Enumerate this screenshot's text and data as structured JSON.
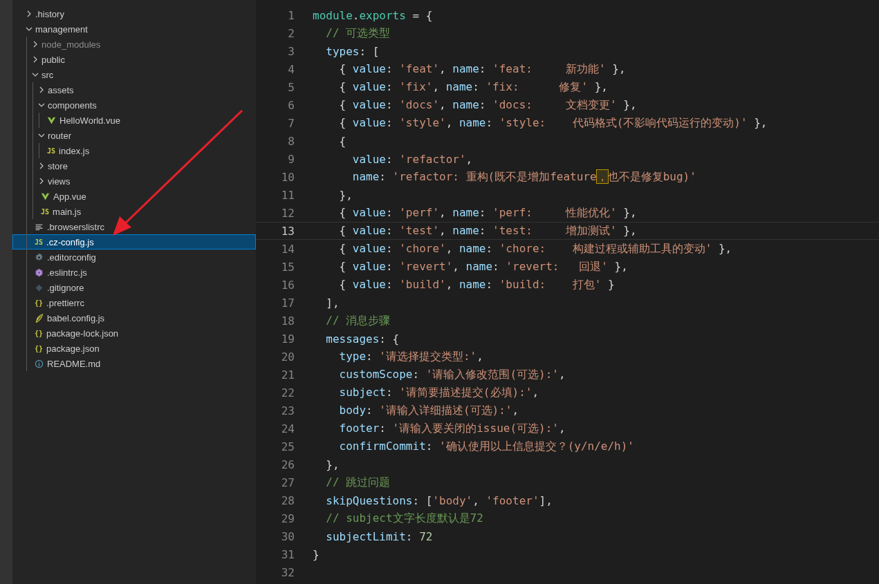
{
  "explorer": {
    "items": [
      {
        "name": ".history",
        "kind": "folder",
        "expanded": false,
        "selected": false,
        "dimmed": false
      },
      {
        "name": "management",
        "kind": "folder",
        "expanded": true,
        "selected": false,
        "dimmed": false,
        "children": [
          {
            "name": "node_modules",
            "kind": "folder",
            "expanded": false,
            "selected": false,
            "dimmed": true
          },
          {
            "name": "public",
            "kind": "folder",
            "expanded": false,
            "selected": false,
            "dimmed": false
          },
          {
            "name": "src",
            "kind": "folder",
            "expanded": true,
            "selected": false,
            "dimmed": false,
            "children": [
              {
                "name": "assets",
                "kind": "folder",
                "expanded": false,
                "selected": false,
                "dimmed": false
              },
              {
                "name": "components",
                "kind": "folder",
                "expanded": true,
                "selected": false,
                "dimmed": false,
                "children": [
                  {
                    "name": "HelloWorld.vue",
                    "kind": "vue",
                    "selected": false,
                    "dimmed": false
                  }
                ]
              },
              {
                "name": "router",
                "kind": "folder",
                "expanded": true,
                "selected": false,
                "dimmed": false,
                "children": [
                  {
                    "name": "index.js",
                    "kind": "js",
                    "icon_text": "JS",
                    "selected": false,
                    "dimmed": false
                  }
                ]
              },
              {
                "name": "store",
                "kind": "folder",
                "expanded": false,
                "selected": false,
                "dimmed": false
              },
              {
                "name": "views",
                "kind": "folder",
                "expanded": false,
                "selected": false,
                "dimmed": false
              },
              {
                "name": "App.vue",
                "kind": "vue",
                "selected": false,
                "dimmed": false
              },
              {
                "name": "main.js",
                "kind": "js",
                "icon_text": "JS",
                "selected": false,
                "dimmed": false
              }
            ]
          },
          {
            "name": ".browserslistrc",
            "kind": "text",
            "selected": false,
            "dimmed": false
          },
          {
            "name": ".cz-config.js",
            "kind": "js",
            "icon_text": "JS",
            "selected": true,
            "dimmed": false
          },
          {
            "name": ".editorconfig",
            "kind": "gear",
            "selected": false,
            "dimmed": false
          },
          {
            "name": ".eslintrc.js",
            "kind": "eslint",
            "selected": false,
            "dimmed": false
          },
          {
            "name": ".gitignore",
            "kind": "git",
            "selected": false,
            "dimmed": false
          },
          {
            "name": ".prettierrc",
            "kind": "json",
            "icon_text": "{}",
            "selected": false,
            "dimmed": false
          },
          {
            "name": "babel.config.js",
            "kind": "babel",
            "selected": false,
            "dimmed": false
          },
          {
            "name": "package-lock.json",
            "kind": "json",
            "icon_text": "{}",
            "selected": false,
            "dimmed": false
          },
          {
            "name": "package.json",
            "kind": "json",
            "icon_text": "{}",
            "selected": false,
            "dimmed": false
          },
          {
            "name": "README.md",
            "kind": "info",
            "selected": false,
            "dimmed": false
          }
        ]
      }
    ]
  },
  "editor": {
    "lines": [
      {
        "number": "1",
        "current": false,
        "tokens": [
          {
            "kind": "keyword",
            "text": "module"
          },
          {
            "kind": "punct",
            "text": "."
          },
          {
            "kind": "keyword",
            "text": "exports"
          },
          {
            "kind": "punct",
            "text": " = {"
          }
        ]
      },
      {
        "number": "2",
        "current": false,
        "tokens": [
          {
            "kind": "comment",
            "text": "  // 可选类型"
          }
        ]
      },
      {
        "number": "3",
        "current": false,
        "tokens": [
          {
            "kind": "property",
            "text": "  types"
          },
          {
            "kind": "punct",
            "text": ": ["
          }
        ]
      },
      {
        "number": "4",
        "current": false,
        "tokens": [
          {
            "kind": "punct",
            "text": "    { "
          },
          {
            "kind": "property",
            "text": "value"
          },
          {
            "kind": "punct",
            "text": ": "
          },
          {
            "kind": "string",
            "text": "'feat'"
          },
          {
            "kind": "punct",
            "text": ", "
          },
          {
            "kind": "property",
            "text": "name"
          },
          {
            "kind": "punct",
            "text": ": "
          },
          {
            "kind": "string",
            "text": "'feat:     新功能'"
          },
          {
            "kind": "punct",
            "text": " },"
          }
        ]
      },
      {
        "number": "5",
        "current": false,
        "tokens": [
          {
            "kind": "punct",
            "text": "    { "
          },
          {
            "kind": "property",
            "text": "value"
          },
          {
            "kind": "punct",
            "text": ": "
          },
          {
            "kind": "string",
            "text": "'fix'"
          },
          {
            "kind": "punct",
            "text": ", "
          },
          {
            "kind": "property",
            "text": "name"
          },
          {
            "kind": "punct",
            "text": ": "
          },
          {
            "kind": "string",
            "text": "'fix:      修复'"
          },
          {
            "kind": "punct",
            "text": " },"
          }
        ]
      },
      {
        "number": "6",
        "current": false,
        "tokens": [
          {
            "kind": "punct",
            "text": "    { "
          },
          {
            "kind": "property",
            "text": "value"
          },
          {
            "kind": "punct",
            "text": ": "
          },
          {
            "kind": "string",
            "text": "'docs'"
          },
          {
            "kind": "punct",
            "text": ", "
          },
          {
            "kind": "property",
            "text": "name"
          },
          {
            "kind": "punct",
            "text": ": "
          },
          {
            "kind": "string",
            "text": "'docs:     文档变更'"
          },
          {
            "kind": "punct",
            "text": " },"
          }
        ]
      },
      {
        "number": "7",
        "current": false,
        "tokens": [
          {
            "kind": "punct",
            "text": "    { "
          },
          {
            "kind": "property",
            "text": "value"
          },
          {
            "kind": "punct",
            "text": ": "
          },
          {
            "kind": "string",
            "text": "'style'"
          },
          {
            "kind": "punct",
            "text": ", "
          },
          {
            "kind": "property",
            "text": "name"
          },
          {
            "kind": "punct",
            "text": ": "
          },
          {
            "kind": "string",
            "text": "'style:    代码格式(不影响代码运行的变动)'"
          },
          {
            "kind": "punct",
            "text": " },"
          }
        ]
      },
      {
        "number": "8",
        "current": false,
        "tokens": [
          {
            "kind": "punct",
            "text": "    {"
          }
        ]
      },
      {
        "number": "9",
        "current": false,
        "tokens": [
          {
            "kind": "property",
            "text": "      value"
          },
          {
            "kind": "punct",
            "text": ": "
          },
          {
            "kind": "string",
            "text": "'refactor'"
          },
          {
            "kind": "punct",
            "text": ","
          }
        ]
      },
      {
        "number": "10",
        "current": false,
        "tokens": [
          {
            "kind": "property",
            "text": "      name"
          },
          {
            "kind": "punct",
            "text": ": "
          },
          {
            "kind": "string",
            "text": "'refactor: 重构(既不是增加feature"
          },
          {
            "kind": "match",
            "text": "，"
          },
          {
            "kind": "string",
            "text": "也不是修复bug)'"
          }
        ]
      },
      {
        "number": "11",
        "current": false,
        "tokens": [
          {
            "kind": "punct",
            "text": "    },"
          }
        ]
      },
      {
        "number": "12",
        "current": false,
        "tokens": [
          {
            "kind": "punct",
            "text": "    { "
          },
          {
            "kind": "property",
            "text": "value"
          },
          {
            "kind": "punct",
            "text": ": "
          },
          {
            "kind": "string",
            "text": "'perf'"
          },
          {
            "kind": "punct",
            "text": ", "
          },
          {
            "kind": "property",
            "text": "name"
          },
          {
            "kind": "punct",
            "text": ": "
          },
          {
            "kind": "string",
            "text": "'perf:     性能优化'"
          },
          {
            "kind": "punct",
            "text": " },"
          }
        ]
      },
      {
        "number": "13",
        "current": true,
        "tokens": [
          {
            "kind": "punct",
            "text": "    { "
          },
          {
            "kind": "property",
            "text": "value"
          },
          {
            "kind": "punct",
            "text": ": "
          },
          {
            "kind": "string",
            "text": "'test'"
          },
          {
            "kind": "punct",
            "text": ", "
          },
          {
            "kind": "property",
            "text": "name"
          },
          {
            "kind": "punct",
            "text": ": "
          },
          {
            "kind": "string",
            "text": "'test:     增加测试'"
          },
          {
            "kind": "punct",
            "text": " },"
          }
        ]
      },
      {
        "number": "14",
        "current": false,
        "tokens": [
          {
            "kind": "punct",
            "text": "    { "
          },
          {
            "kind": "property",
            "text": "value"
          },
          {
            "kind": "punct",
            "text": ": "
          },
          {
            "kind": "string",
            "text": "'chore'"
          },
          {
            "kind": "punct",
            "text": ", "
          },
          {
            "kind": "property",
            "text": "name"
          },
          {
            "kind": "punct",
            "text": ": "
          },
          {
            "kind": "string",
            "text": "'chore:    构建过程或辅助工具的变动'"
          },
          {
            "kind": "punct",
            "text": " },"
          }
        ]
      },
      {
        "number": "15",
        "current": false,
        "tokens": [
          {
            "kind": "punct",
            "text": "    { "
          },
          {
            "kind": "property",
            "text": "value"
          },
          {
            "kind": "punct",
            "text": ": "
          },
          {
            "kind": "string",
            "text": "'revert'"
          },
          {
            "kind": "punct",
            "text": ", "
          },
          {
            "kind": "property",
            "text": "name"
          },
          {
            "kind": "punct",
            "text": ": "
          },
          {
            "kind": "string",
            "text": "'revert:   回退'"
          },
          {
            "kind": "punct",
            "text": " },"
          }
        ]
      },
      {
        "number": "16",
        "current": false,
        "tokens": [
          {
            "kind": "punct",
            "text": "    { "
          },
          {
            "kind": "property",
            "text": "value"
          },
          {
            "kind": "punct",
            "text": ": "
          },
          {
            "kind": "string",
            "text": "'build'"
          },
          {
            "kind": "punct",
            "text": ", "
          },
          {
            "kind": "property",
            "text": "name"
          },
          {
            "kind": "punct",
            "text": ": "
          },
          {
            "kind": "string",
            "text": "'build:    打包'"
          },
          {
            "kind": "punct",
            "text": " }"
          }
        ]
      },
      {
        "number": "17",
        "current": false,
        "tokens": [
          {
            "kind": "punct",
            "text": "  ],"
          }
        ]
      },
      {
        "number": "18",
        "current": false,
        "tokens": [
          {
            "kind": "comment",
            "text": "  // 消息步骤"
          }
        ]
      },
      {
        "number": "19",
        "current": false,
        "tokens": [
          {
            "kind": "property",
            "text": "  messages"
          },
          {
            "kind": "punct",
            "text": ": {"
          }
        ]
      },
      {
        "number": "20",
        "current": false,
        "tokens": [
          {
            "kind": "property",
            "text": "    type"
          },
          {
            "kind": "punct",
            "text": ": "
          },
          {
            "kind": "string",
            "text": "'请选择提交类型:'"
          },
          {
            "kind": "punct",
            "text": ","
          }
        ]
      },
      {
        "number": "21",
        "current": false,
        "tokens": [
          {
            "kind": "property",
            "text": "    customScope"
          },
          {
            "kind": "punct",
            "text": ": "
          },
          {
            "kind": "string",
            "text": "'请输入修改范围(可选):'"
          },
          {
            "kind": "punct",
            "text": ","
          }
        ]
      },
      {
        "number": "22",
        "current": false,
        "tokens": [
          {
            "kind": "property",
            "text": "    subject"
          },
          {
            "kind": "punct",
            "text": ": "
          },
          {
            "kind": "string",
            "text": "'请简要描述提交(必填):'"
          },
          {
            "kind": "punct",
            "text": ","
          }
        ]
      },
      {
        "number": "23",
        "current": false,
        "tokens": [
          {
            "kind": "property",
            "text": "    body"
          },
          {
            "kind": "punct",
            "text": ": "
          },
          {
            "kind": "string",
            "text": "'请输入详细描述(可选):'"
          },
          {
            "kind": "punct",
            "text": ","
          }
        ]
      },
      {
        "number": "24",
        "current": false,
        "tokens": [
          {
            "kind": "property",
            "text": "    footer"
          },
          {
            "kind": "punct",
            "text": ": "
          },
          {
            "kind": "string",
            "text": "'请输入要关闭的issue(可选):'"
          },
          {
            "kind": "punct",
            "text": ","
          }
        ]
      },
      {
        "number": "25",
        "current": false,
        "tokens": [
          {
            "kind": "property",
            "text": "    confirmCommit"
          },
          {
            "kind": "punct",
            "text": ": "
          },
          {
            "kind": "string",
            "text": "'确认使用以上信息提交？(y/n/e/h)'"
          }
        ]
      },
      {
        "number": "26",
        "current": false,
        "tokens": [
          {
            "kind": "punct",
            "text": "  },"
          }
        ]
      },
      {
        "number": "27",
        "current": false,
        "tokens": [
          {
            "kind": "comment",
            "text": "  // 跳过问题"
          }
        ]
      },
      {
        "number": "28",
        "current": false,
        "tokens": [
          {
            "kind": "property",
            "text": "  skipQuestions"
          },
          {
            "kind": "punct",
            "text": ": ["
          },
          {
            "kind": "string",
            "text": "'body'"
          },
          {
            "kind": "punct",
            "text": ", "
          },
          {
            "kind": "string",
            "text": "'footer'"
          },
          {
            "kind": "punct",
            "text": "],"
          }
        ]
      },
      {
        "number": "29",
        "current": false,
        "tokens": [
          {
            "kind": "comment",
            "text": "  // subject文字长度默认是72"
          }
        ]
      },
      {
        "number": "30",
        "current": false,
        "tokens": [
          {
            "kind": "property",
            "text": "  subjectLimit"
          },
          {
            "kind": "punct",
            "text": ": "
          },
          {
            "kind": "number",
            "text": "72"
          }
        ]
      },
      {
        "number": "31",
        "current": false,
        "tokens": [
          {
            "kind": "punct",
            "text": "}"
          }
        ]
      },
      {
        "number": "32",
        "current": false
      }
    ]
  }
}
